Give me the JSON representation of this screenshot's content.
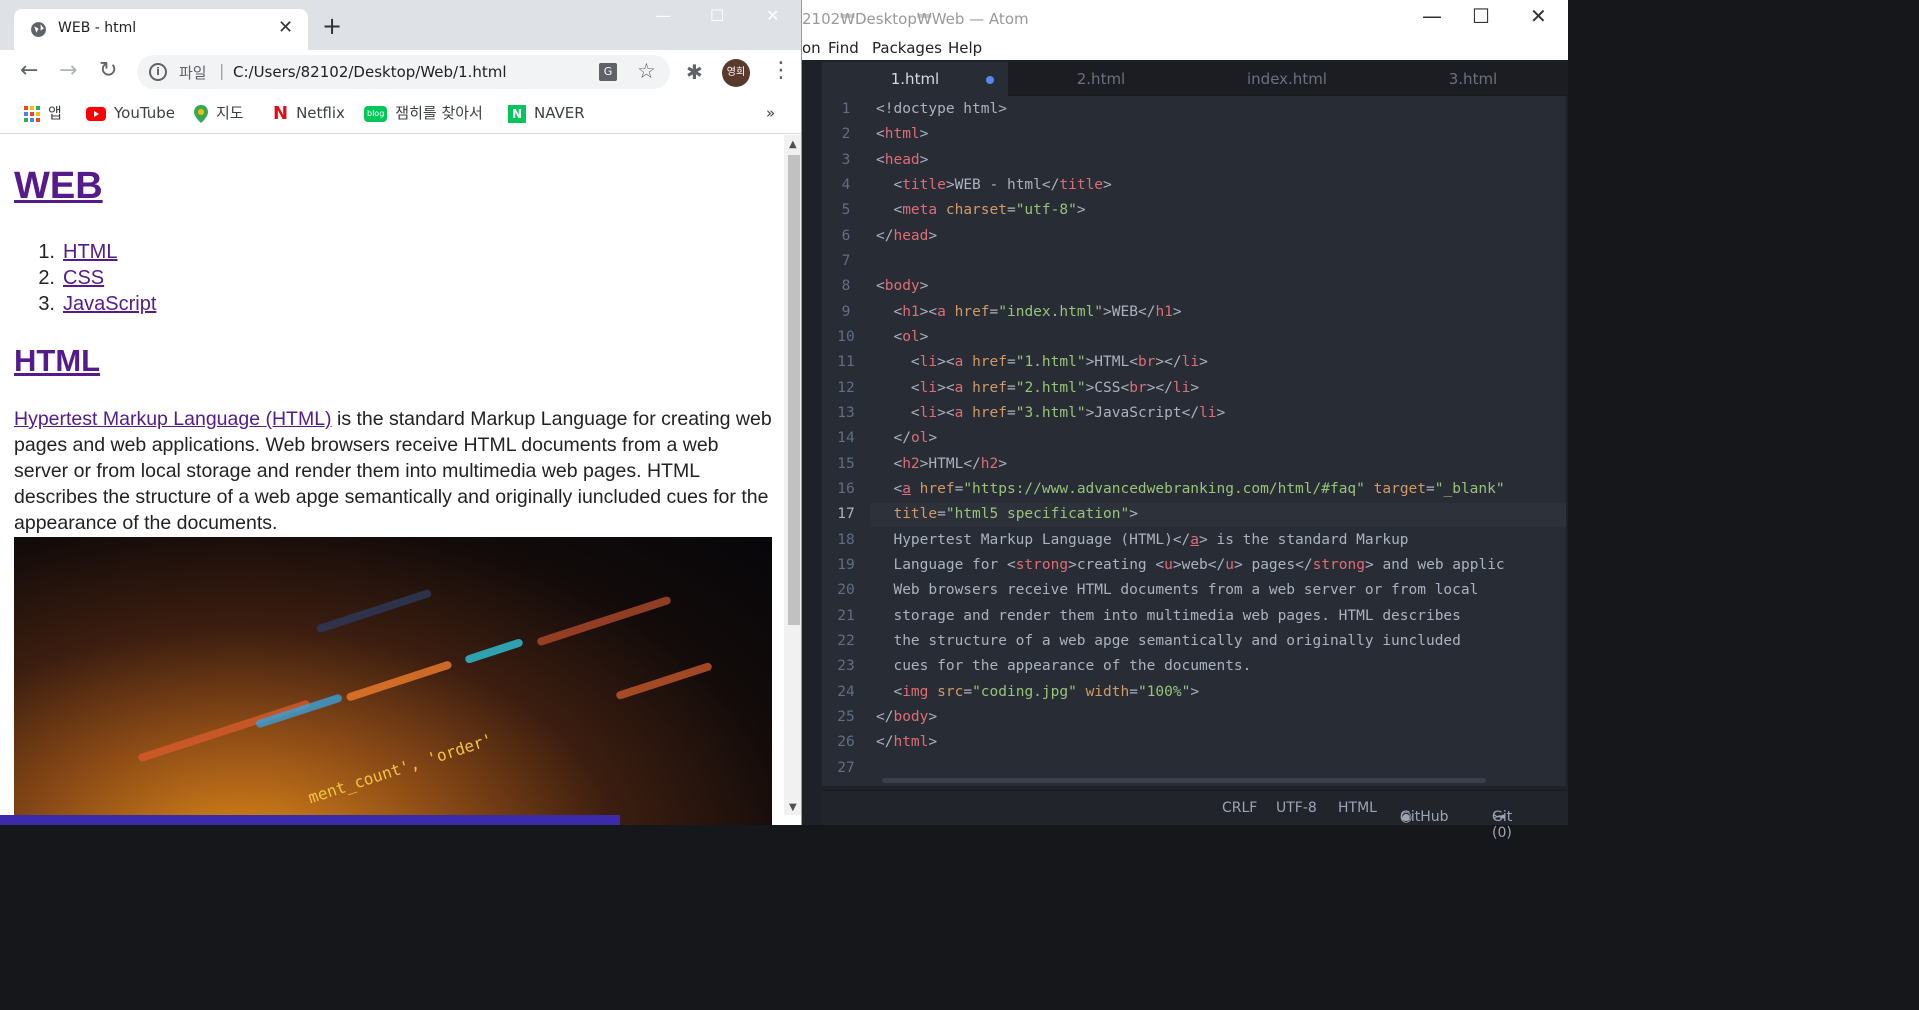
{
  "browser": {
    "tab_title": "WEB - html",
    "tab_close": "✕",
    "new_tab": "+",
    "url_scheme": "파일",
    "url": "C:/Users/82102/Desktop/Web/1.html",
    "avatar_text": "영희",
    "bookmarks": [
      "앱",
      "YouTube",
      "지도",
      "Netflix",
      "잼히를 찾아서",
      "NAVER"
    ],
    "more_bookmarks": "»"
  },
  "page": {
    "h1": "WEB",
    "list": [
      {
        "num": "1.",
        "label": "HTML"
      },
      {
        "num": "2.",
        "label": "CSS"
      },
      {
        "num": "3.",
        "label": "JavaScript"
      }
    ],
    "h2": "HTML",
    "intro_link": "Hypertest Markup Language (HTML)",
    "intro_rest": " is the standard Markup Language for creating web pages and web applications. Web browsers receive HTML documents from a web server or from local storage and render them into multimedia web pages. HTML describes the structure of a web apge semantically and originally iuncluded cues for the appearance of the documents.",
    "image_caption_text": "ment_count', 'order'"
  },
  "atom": {
    "title": "2102₩Desktop₩Web — Atom",
    "menu": [
      "on",
      "Find",
      "Packages",
      "Help"
    ],
    "tabs": [
      "1.html",
      "2.html",
      "index.html",
      "3.html"
    ],
    "active_tab": "1.html",
    "current_line": 17,
    "status": [
      "CRLF",
      "UTF-8",
      "HTML",
      "GitHub",
      "Git (0)"
    ]
  },
  "colors": {
    "link_visited": "#551a8b",
    "atom_bg": "#282c34",
    "tag": "#e06c75",
    "attr": "#d19a66",
    "string": "#98c379"
  }
}
